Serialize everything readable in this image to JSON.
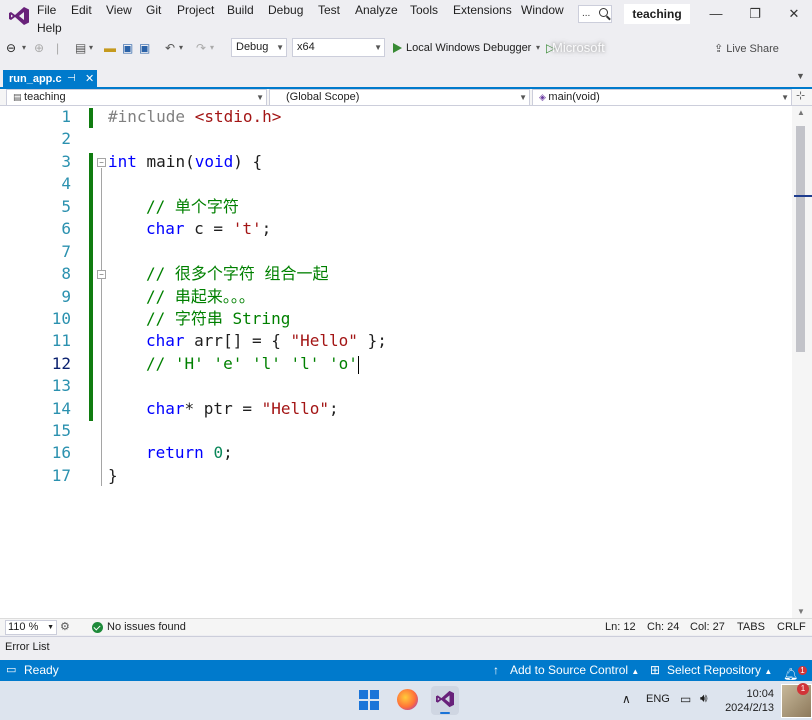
{
  "menu": {
    "items": [
      "File",
      "Edit",
      "View",
      "Git",
      "Project",
      "Build",
      "Debug",
      "Test",
      "Analyze",
      "Tools",
      "Extensions",
      "Window",
      "Help"
    ],
    "search_label": "...",
    "solution_name": "teaching"
  },
  "toolbar": {
    "config": "Debug",
    "platform": "x64",
    "run_label": "Local Windows Debugger",
    "live_share": "Live Share",
    "blurred_text": "Microsoft"
  },
  "tabs": [
    {
      "label": "run_app.c",
      "pin": "⊣",
      "close": "✕",
      "active": true
    }
  ],
  "navbar": {
    "project": "teaching",
    "scope": "(Global Scope)",
    "member": "main(void)"
  },
  "editor": {
    "line_numbers": [
      "1",
      "2",
      "3",
      "4",
      "5",
      "6",
      "7",
      "8",
      "9",
      "10",
      "11",
      "12",
      "13",
      "14",
      "15",
      "16",
      "17"
    ],
    "active_line": "12",
    "code": {
      "l1_pp": "#include ",
      "l1_inc": "<stdio.h>",
      "l3_kw": "int",
      "l3_rest": " main(",
      "l3_kw2": "void",
      "l3_end": ") {",
      "l5": "// 单个字符",
      "l6_kw": "char",
      "l6_mid": " c = ",
      "l6_str": "'t'",
      "l6_end": ";",
      "l8": "// 很多个字符 组合一起",
      "l9": "// 串起来。。。",
      "l10": "// 字符串 String",
      "l11_kw": "char",
      "l11_mid": " arr[] = { ",
      "l11_str": "\"Hello\"",
      "l11_end": " };",
      "l12": "// 'H' 'e' 'l' 'l' 'o'",
      "l14_kw": "char",
      "l14_mid": "* ptr = ",
      "l14_str": "\"Hello\"",
      "l14_end": ";",
      "l16_kw": "return",
      "l16_sp": " ",
      "l16_num": "0",
      "l16_end": ";",
      "l17": "}"
    }
  },
  "editor_status": {
    "zoom": "110 %",
    "issues": "No issues found",
    "ln": "Ln: 12",
    "ch": "Ch: 24",
    "col": "Col: 27",
    "tabs": "TABS",
    "eol": "CRLF"
  },
  "error_list": "Error List",
  "statusbar": {
    "ready": "Ready",
    "source_control": "Add to Source Control",
    "repository": "Select Repository",
    "notifications": "1"
  },
  "taskbar": {
    "lang": "ENG",
    "time": "10:04",
    "date": "2024/2/13"
  },
  "colors": {
    "accent": "#007acc",
    "keyword": "#0000ff",
    "string": "#a31515",
    "comment": "#008000",
    "line_number": "#2b91af",
    "change_bar": "#107c10"
  }
}
